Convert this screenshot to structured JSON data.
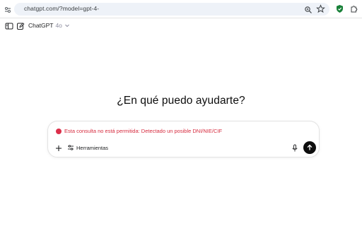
{
  "browser": {
    "url": "chatgpt.com/?model=gpt-4-",
    "icons": [
      "site-info-icon",
      "zoom-icon",
      "star-icon",
      "shield-extension-icon",
      "puzzle-extension-icon"
    ]
  },
  "header": {
    "model_name": "ChatGPT",
    "model_version": "4o",
    "icons": [
      "sidebar-toggle-icon",
      "new-chat-icon",
      "chevron-down-icon"
    ]
  },
  "main": {
    "heading": "¿En qué puedo ayudarte?"
  },
  "composer": {
    "warning": "Esta consulta no está permitida: Detectado un posible DNI/NIE/CIF",
    "tools_label": "Herramientas",
    "icons": [
      "plus-icon",
      "sliders-icon",
      "microphone-icon",
      "arrow-up-icon"
    ]
  },
  "colors": {
    "warning": "#d62b3e",
    "send_button": "#0d0d0d",
    "omnibox": "#eef2f8"
  }
}
